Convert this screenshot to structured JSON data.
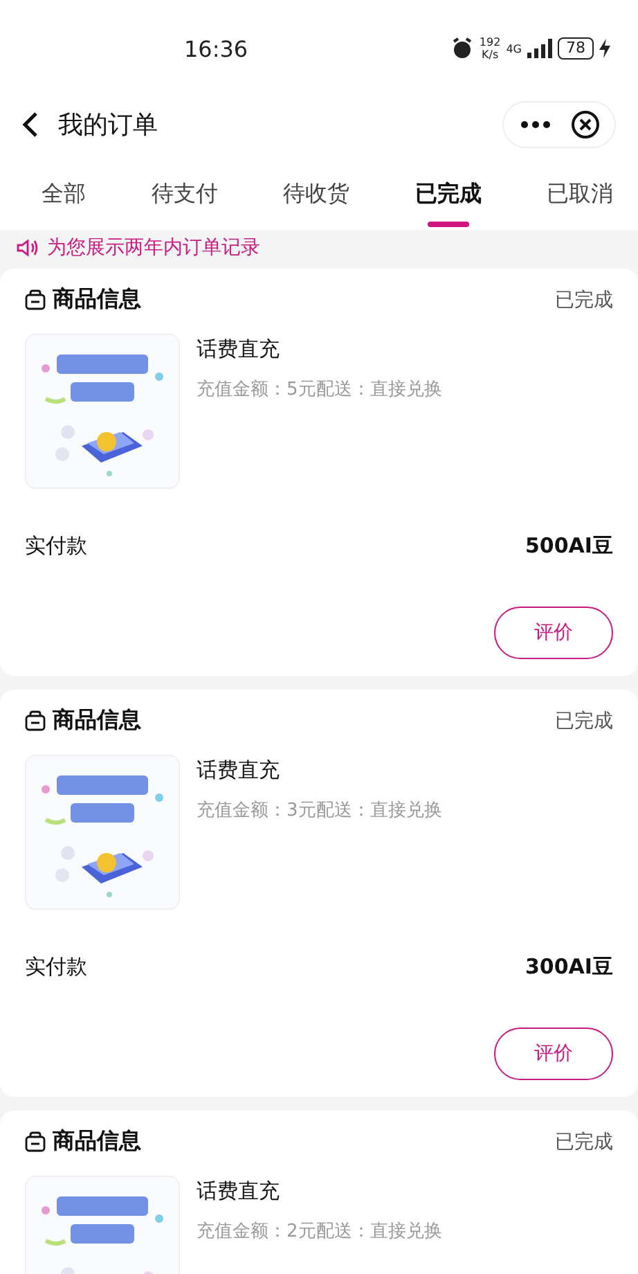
{
  "status_bar": {
    "time": "16:36",
    "speed_value": "192",
    "speed_unit": "K/s",
    "network": "4G",
    "battery": "78",
    "charging": true
  },
  "header": {
    "title": "我的订单"
  },
  "tabs": [
    {
      "label": "全部",
      "selected": false
    },
    {
      "label": "待支付",
      "selected": false
    },
    {
      "label": "待收货",
      "selected": false
    },
    {
      "label": "已完成",
      "selected": true
    },
    {
      "label": "已取消",
      "selected": false
    }
  ],
  "notice": "为您展示两年内订单记录",
  "orders": [
    {
      "section_title": "商品信息",
      "status": "已完成",
      "product": {
        "kind": "picture",
        "name": "话费直充",
        "details": "充值金额：5元配送：直接兑换"
      },
      "paid_label": "实付款",
      "paid_amount": "500AI豆",
      "action": "评价"
    },
    {
      "section_title": "商品信息",
      "status": "已完成",
      "product": {
        "kind": "picture",
        "name": "话费直充",
        "details": "充值金额：3元配送：直接兑换"
      },
      "paid_label": "实付款",
      "paid_amount": "300AI豆",
      "action": "评价"
    },
    {
      "section_title": "商品信息",
      "status": "已完成",
      "product": {
        "kind": "picture",
        "name": "话费直充",
        "details": "充值金额：2元配送：直接兑换"
      }
    }
  ]
}
